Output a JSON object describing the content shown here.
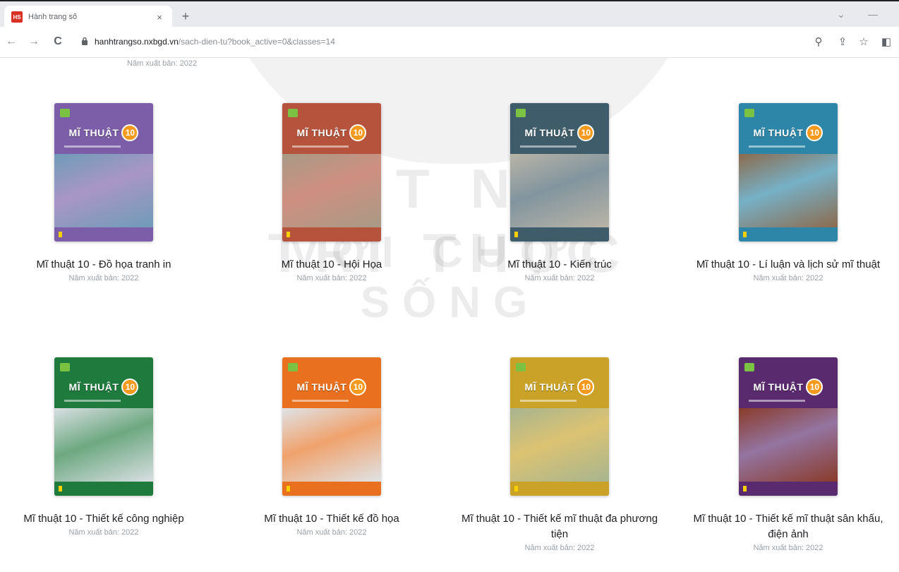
{
  "browser": {
    "tab_title": "Hành trang số",
    "tab_close": "×",
    "new_tab": "+",
    "url_domain": "hanhtrangso.nxbgd.vn",
    "url_path": "/sach-dien-tu?book_active=0&classes=14",
    "back": "←",
    "forward": "→",
    "reload": "C",
    "minimize": "⌄",
    "restore": "—",
    "zoom_icon": "⚲",
    "share_icon": "⇪",
    "star_icon": "☆",
    "panel_icon": "◧"
  },
  "page": {
    "top_year": "Năm xuất bản: 2022",
    "watermark_line1": "KẾT NỐI TRI THỨC",
    "watermark_line2": "VỚI CUỘC SỐNG"
  },
  "books": [
    {
      "title": "Mĩ thuật 10 - Đồ họa tranh in",
      "year": "Năm xuất bản: 2022",
      "cover_label": "MĨ THUẬT",
      "cover_number": "10",
      "color": "#7b5ea7",
      "art": "#6f9bb8"
    },
    {
      "title": "Mĩ thuật 10 - Hội Họa",
      "year": "Năm xuất bản: 2022",
      "cover_label": "MĨ THUẬT",
      "cover_number": "10",
      "color": "#b5533c",
      "art": "#a89a86"
    },
    {
      "title": "Mĩ thuật 10 - Kiến trúc",
      "year": "Năm xuất bản: 2022",
      "cover_label": "MĨ THUẬT",
      "cover_number": "10",
      "color": "#3f5c6b",
      "art": "#b9b4a7"
    },
    {
      "title": "Mĩ thuật 10 - Lí luận và lịch sử mĩ thuật",
      "year": "Năm xuất bản: 2022",
      "cover_label": "MĨ THUẬT",
      "cover_number": "10",
      "color": "#2d86a8",
      "art": "#8c6b4e"
    },
    {
      "title": "Mĩ thuật 10 - Thiết kế công nghiệp",
      "year": "Năm xuất bản: 2022",
      "cover_label": "MĨ THUẬT",
      "cover_number": "10",
      "color": "#1f7a3d",
      "art": "#d9dfe3"
    },
    {
      "title": "Mĩ thuật 10 - Thiết kế đồ họa",
      "year": "Năm xuất bản: 2022",
      "cover_label": "MĨ THUẬT",
      "cover_number": "10",
      "color": "#e8701e",
      "art": "#dfe3e6"
    },
    {
      "title": "Mĩ thuật 10 - Thiết kế mĩ thuật đa phương tiện",
      "year": "Năm xuất bản: 2022",
      "cover_label": "MĨ THUẬT",
      "cover_number": "10",
      "color": "#c9a227",
      "art": "#a7b58f"
    },
    {
      "title": "Mĩ thuật 10 - Thiết kế mĩ thuật sân khấu, điện ảnh",
      "year": "Năm xuất bản: 2022",
      "cover_label": "MĨ THUẬT",
      "cover_number": "10",
      "color": "#5a2a6e",
      "art": "#8a3b2a"
    }
  ]
}
